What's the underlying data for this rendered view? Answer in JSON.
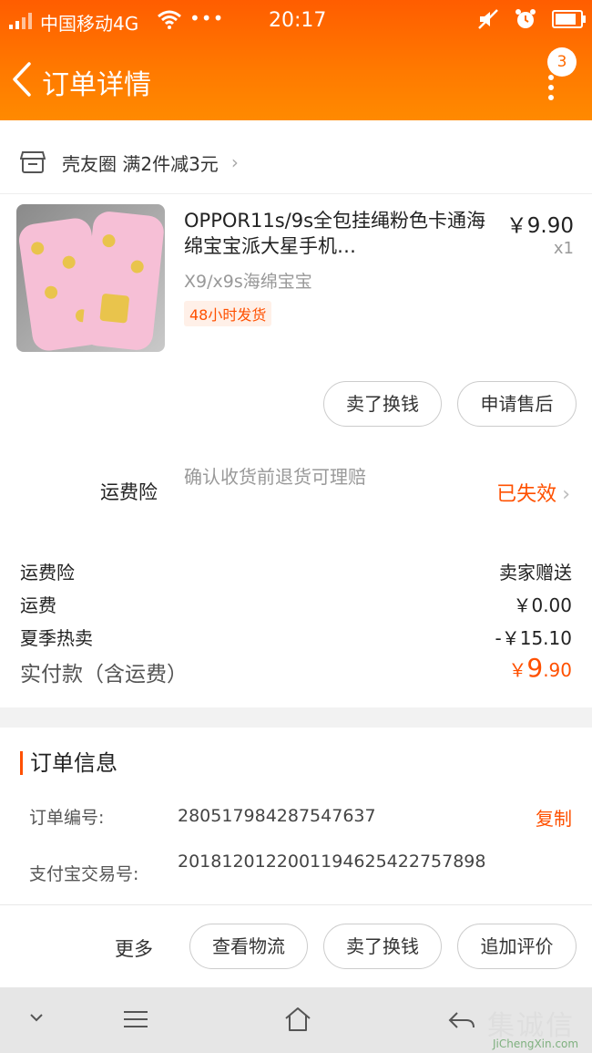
{
  "status_bar": {
    "carrier": "中国移动4G",
    "dots": "•••",
    "time": "20:17"
  },
  "nav": {
    "title": "订单详情",
    "badge_count": "3"
  },
  "shop": {
    "name": "壳友圈 满2件减3元",
    "chevron": "›"
  },
  "product": {
    "name": "OPPOR11s/9s全包挂绳粉色卡通海绵宝宝派大星手机…",
    "price": "￥9.90",
    "quantity": "x1",
    "sku": "X9/x9s海绵宝宝",
    "tag": "48小时发货"
  },
  "item_actions": {
    "sell_label": "卖了换钱",
    "aftersale_label": "申请售后"
  },
  "insurance": {
    "label": "运费险",
    "description": "确认收货前退货可理赔",
    "status": "已失效",
    "chevron": "›"
  },
  "summary": [
    {
      "label": "运费险",
      "value": "卖家赠送"
    },
    {
      "label": "运费",
      "value": "￥0.00"
    },
    {
      "label": "夏季热卖",
      "value": "-￥15.10"
    }
  ],
  "total": {
    "label": "实付款（含运费）",
    "currency": "￥",
    "integer": "9",
    "decimal": ".90"
  },
  "order_info": {
    "section_title": "订单信息",
    "order_no_label": "订单编号:",
    "order_no_value": "280517984287547637",
    "copy_label": "复制",
    "alipay_label": "支付宝交易号:",
    "alipay_value": "2018120122001194625422757898"
  },
  "bottom_actions": {
    "more_label": "更多",
    "logistics_label": "查看物流",
    "sell_label": "卖了换钱",
    "review_label": "追加评价"
  },
  "watermark": {
    "text": "集诚信",
    "sub": "JiChengXin.com"
  },
  "colors": {
    "accent": "#ff5000",
    "header_start": "#ff5d00",
    "header_end": "#ff8a00"
  }
}
